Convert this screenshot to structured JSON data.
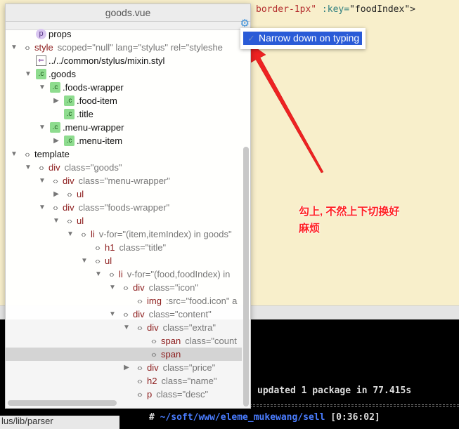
{
  "editor": {
    "top_line": {
      "tag_end": "border-1px\"",
      "attr": " :key=",
      "value": "\"foodIndex\">"
    }
  },
  "terminal": {
    "line1": "updated 1 package in 77.415s",
    "prompt": "#",
    "path": "~/soft/www/eleme_mukewang/sell",
    "time": "[0:36:02]",
    "status_path": "lus/lib/parser"
  },
  "popup": {
    "title": "goods.vue",
    "settings_icon": "gear-icon",
    "rows": [
      {
        "level": 1,
        "toggle": "none",
        "icon": "prop",
        "name": "props",
        "attrs": ""
      },
      {
        "level": 0,
        "toggle": "expanded",
        "icon": "tag",
        "name": "style",
        "attrs": "scoped=\"null\" lang=\"stylus\" rel=\"styleshe"
      },
      {
        "level": 1,
        "toggle": "none",
        "icon": "import",
        "name": "../../common/stylus/mixin.styl",
        "attrs": ""
      },
      {
        "level": 1,
        "toggle": "expanded",
        "icon": "css",
        "name": ".goods",
        "attrs": ""
      },
      {
        "level": 2,
        "toggle": "expanded",
        "icon": "css",
        "name": ".foods-wrapper",
        "attrs": ""
      },
      {
        "level": 3,
        "toggle": "collapsed",
        "icon": "css",
        "name": ".food-item",
        "attrs": ""
      },
      {
        "level": 3,
        "toggle": "none",
        "icon": "css",
        "name": ".title",
        "attrs": ""
      },
      {
        "level": 2,
        "toggle": "expanded",
        "icon": "css",
        "name": ".menu-wrapper",
        "attrs": ""
      },
      {
        "level": 3,
        "toggle": "collapsed",
        "icon": "css",
        "name": ".menu-item",
        "attrs": ""
      },
      {
        "level": 0,
        "toggle": "expanded",
        "icon": "tag",
        "name": "template",
        "attrs": ""
      },
      {
        "level": 1,
        "toggle": "expanded",
        "icon": "tag",
        "name": "div",
        "attrs": "class=\"goods\""
      },
      {
        "level": 2,
        "toggle": "expanded",
        "icon": "tag",
        "name": "div",
        "attrs": "class=\"menu-wrapper\""
      },
      {
        "level": 3,
        "toggle": "collapsed",
        "icon": "tag",
        "name": "ul",
        "attrs": ""
      },
      {
        "level": 2,
        "toggle": "expanded",
        "icon": "tag",
        "name": "div",
        "attrs": "class=\"foods-wrapper\""
      },
      {
        "level": 3,
        "toggle": "expanded",
        "icon": "tag",
        "name": "ul",
        "attrs": ""
      },
      {
        "level": 4,
        "toggle": "expanded",
        "icon": "tag",
        "name": "li",
        "attrs": "v-for=\"(item,itemIndex) in goods\""
      },
      {
        "level": 5,
        "toggle": "none",
        "icon": "tag",
        "name": "h1",
        "attrs": "class=\"title\""
      },
      {
        "level": 5,
        "toggle": "expanded",
        "icon": "tag",
        "name": "ul",
        "attrs": ""
      },
      {
        "level": 6,
        "toggle": "expanded",
        "icon": "tag",
        "name": "li",
        "attrs": "v-for=\"(food,foodIndex) in"
      },
      {
        "level": 7,
        "toggle": "expanded",
        "icon": "tag",
        "name": "div",
        "attrs": "class=\"icon\""
      },
      {
        "level": 8,
        "toggle": "none",
        "icon": "tag",
        "name": "img",
        "attrs": ":src=\"food.icon\" a"
      },
      {
        "level": 7,
        "toggle": "expanded",
        "icon": "tag",
        "name": "div",
        "attrs": "class=\"content\""
      },
      {
        "level": 8,
        "toggle": "expanded",
        "icon": "tag",
        "name": "div",
        "attrs": "class=\"extra\""
      },
      {
        "level": 9,
        "toggle": "none",
        "icon": "tag",
        "name": "span",
        "attrs": "class=\"count"
      },
      {
        "level": 9,
        "toggle": "none",
        "icon": "tag",
        "name": "span",
        "attrs": "",
        "selected": true
      },
      {
        "level": 8,
        "toggle": "collapsed",
        "icon": "tag",
        "name": "div",
        "attrs": "class=\"price\""
      },
      {
        "level": 8,
        "toggle": "none",
        "icon": "tag",
        "name": "h2",
        "attrs": "class=\"name\""
      },
      {
        "level": 8,
        "toggle": "none",
        "icon": "tag",
        "name": "p",
        "attrs": "class=\"desc\""
      }
    ]
  },
  "settings_menu": {
    "item": "Narrow down on typing",
    "checked": true
  },
  "annotation": {
    "line1": "勾上, 不然上下切换好",
    "line2": "麻烦",
    "color": "#ff2222"
  }
}
